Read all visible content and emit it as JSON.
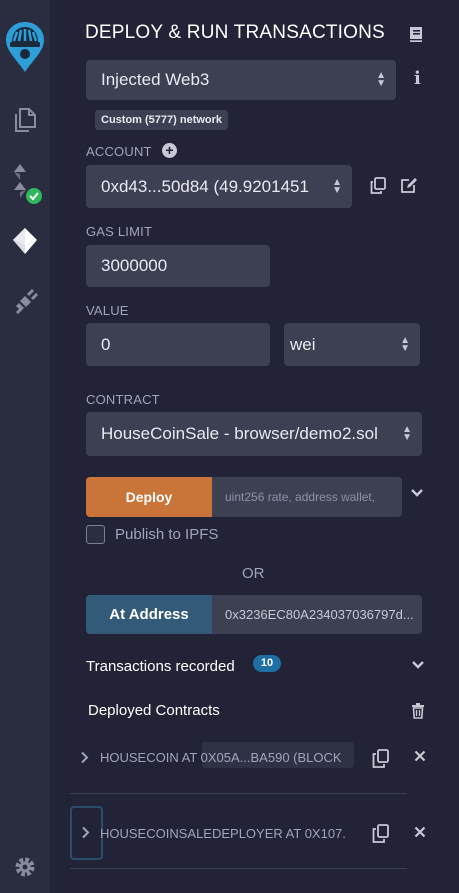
{
  "rail": {
    "icons": [
      "remix-logo-icon",
      "file-explorer-icon",
      "solidity-compiler-icon",
      "deploy-run-icon",
      "plugin-manager-icon",
      "settings-icon"
    ],
    "compile_status": "success"
  },
  "header": {
    "title": "DEPLOY & RUN TRANSACTIONS",
    "doc_icon": "book-icon"
  },
  "environment": {
    "selected": "Injected Web3",
    "network_badge": "Custom (5777) network"
  },
  "account": {
    "label": "ACCOUNT",
    "selected": "0xd43...50d84 (49.9201451"
  },
  "gas_limit": {
    "label": "GAS LIMIT",
    "value": "3000000"
  },
  "value": {
    "label": "VALUE",
    "amount": "0",
    "unit": "wei"
  },
  "contract": {
    "label": "CONTRACT",
    "selected": "HouseCoinSale - browser/demo2.sol"
  },
  "deploy": {
    "button_label": "Deploy",
    "args_placeholder": "uint256 rate, address wallet,"
  },
  "publish": {
    "label": "Publish to IPFS",
    "checked": false
  },
  "or_label": "OR",
  "at_address": {
    "button_label": "At Address",
    "value": "0x3236EC80A234037036797d..."
  },
  "transactions": {
    "label": "Transactions recorded",
    "count": "10"
  },
  "deployed": {
    "label": "Deployed Contracts",
    "items": [
      {
        "name": "HOUSECOIN AT 0X05A...BA590 (BLOCK"
      },
      {
        "name": "HOUSECOINSALEDEPLOYER AT 0X107."
      }
    ]
  },
  "colors": {
    "background": "#222336",
    "rail": "#2a2c3f",
    "field": "#3d3f52",
    "deploy": "#c97539",
    "at_address": "#335a79",
    "badge": "#1e6fa3",
    "success": "#2eb85c",
    "brand": "#2d9ed7"
  }
}
